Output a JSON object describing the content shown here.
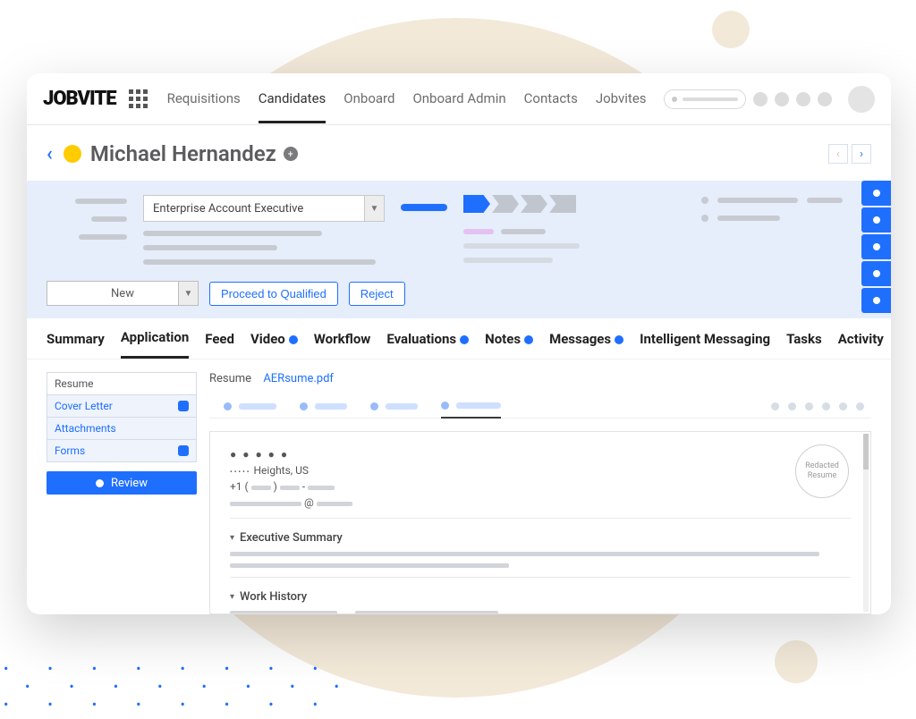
{
  "brand": "JOBVITE",
  "nav": {
    "items": [
      "Requisitions",
      "Candidates",
      "Onboard",
      "Onboard Admin",
      "Contacts",
      "Jobvites"
    ],
    "active_index": 1
  },
  "candidate": {
    "name": "Michael Hernandez"
  },
  "requisition": {
    "selected": "Enterprise Account Executive"
  },
  "status": {
    "selected": "New"
  },
  "actions": {
    "proceed": "Proceed to Qualified",
    "reject": "Reject"
  },
  "section_tabs": {
    "items": [
      {
        "label": "Summary",
        "badge": false
      },
      {
        "label": "Application",
        "badge": false,
        "active": true
      },
      {
        "label": "Feed",
        "badge": false
      },
      {
        "label": "Video",
        "badge": true
      },
      {
        "label": "Workflow",
        "badge": false
      },
      {
        "label": "Evaluations",
        "badge": true
      },
      {
        "label": "Notes",
        "badge": true
      },
      {
        "label": "Messages",
        "badge": true
      },
      {
        "label": "Intelligent Messaging",
        "badge": false
      },
      {
        "label": "Tasks",
        "badge": false
      },
      {
        "label": "Activity",
        "badge": false
      }
    ]
  },
  "left_list": {
    "header": "Resume",
    "items": [
      "Cover Letter",
      "Attachments",
      "Forms"
    ],
    "review": "Review"
  },
  "resume": {
    "label": "Resume",
    "file": "AERsume.pdf",
    "location_suffix": " Heights, US",
    "phone_prefix": "+1 (",
    "phone_mid": ") ",
    "phone_dash": " - ",
    "at": " @ ",
    "sections": [
      "Executive Summary",
      "Work History"
    ],
    "stamp": "Redacted Resume"
  }
}
